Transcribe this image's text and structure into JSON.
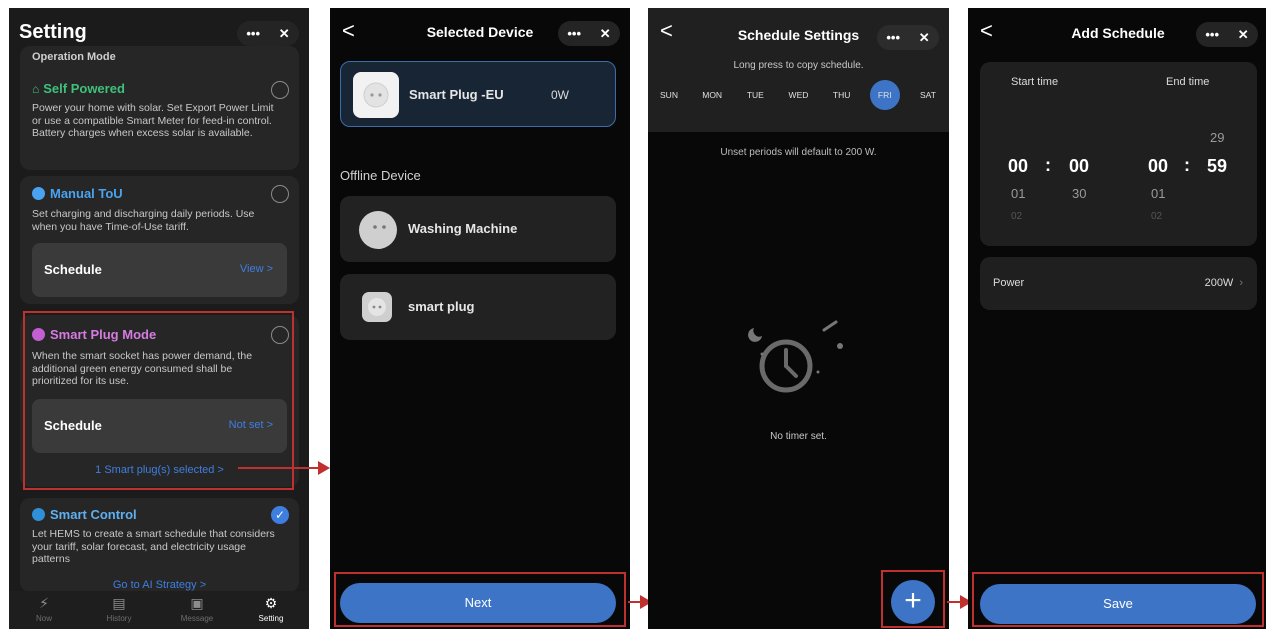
{
  "panel1": {
    "title": "Setting",
    "section_label": "Operation Mode",
    "self_powered": {
      "title": "Self Powered",
      "description": "Power your home with solar. Set Export Power Limit or use a compatible Smart Meter for feed-in control. Battery charges when excess solar is available."
    },
    "manual_tou": {
      "title": "Manual ToU",
      "description": "Set charging and discharging daily periods. Use when you have Time-of-Use tariff.",
      "schedule_label": "Schedule",
      "schedule_value": "View >"
    },
    "smart_plug_mode": {
      "title": "Smart Plug Mode",
      "description": "When the smart socket has power demand, the additional green energy consumed shall be prioritized for its use.",
      "schedule_label": "Schedule",
      "schedule_value": "Not set >",
      "selected_link": "1 Smart plug(s) selected >"
    },
    "smart_control": {
      "title": "Smart Control",
      "description": "Let HEMS to create a smart schedule that considers your tariff, solar forecast, and electricity usage patterns",
      "link": "Go to AI Strategy >"
    },
    "tabs": [
      "Now",
      "History",
      "Message",
      "Setting"
    ],
    "menu_icon": "•••",
    "close_icon": "✕",
    "accent_color": "#3f7ee1",
    "highlight_color": "#c0302f"
  },
  "panel2": {
    "back": "<",
    "title": "Selected Device",
    "selected_device": {
      "name": "Smart Plug -EU",
      "power": "0W"
    },
    "offline_label": "Offline Device",
    "offline_devices": [
      "Washing Machine",
      "smart plug"
    ],
    "next_button": "Next"
  },
  "panel3": {
    "back": "<",
    "title": "Schedule Settings",
    "hint": "Long press to copy schedule.",
    "days": [
      "SUN",
      "MON",
      "TUE",
      "WED",
      "THU",
      "FRI",
      "SAT"
    ],
    "selected_day": "FRI",
    "unset_note": "Unset periods will default to 200 W.",
    "empty_text": "No timer set.",
    "add_icon": "+"
  },
  "panel4": {
    "back": "<",
    "title": "Add Schedule",
    "start_label": "Start time",
    "end_label": "End time",
    "start": {
      "hour": "00",
      "minute": "00",
      "hour_next": "01",
      "minute_next": "30",
      "hour_next2": "02"
    },
    "end": {
      "minute_prev": "29",
      "hour": "00",
      "minute": "59",
      "hour_next": "01",
      "hour_next2": "02"
    },
    "separator": ":",
    "power_label": "Power",
    "power_value": "200W",
    "save_button": "Save"
  }
}
